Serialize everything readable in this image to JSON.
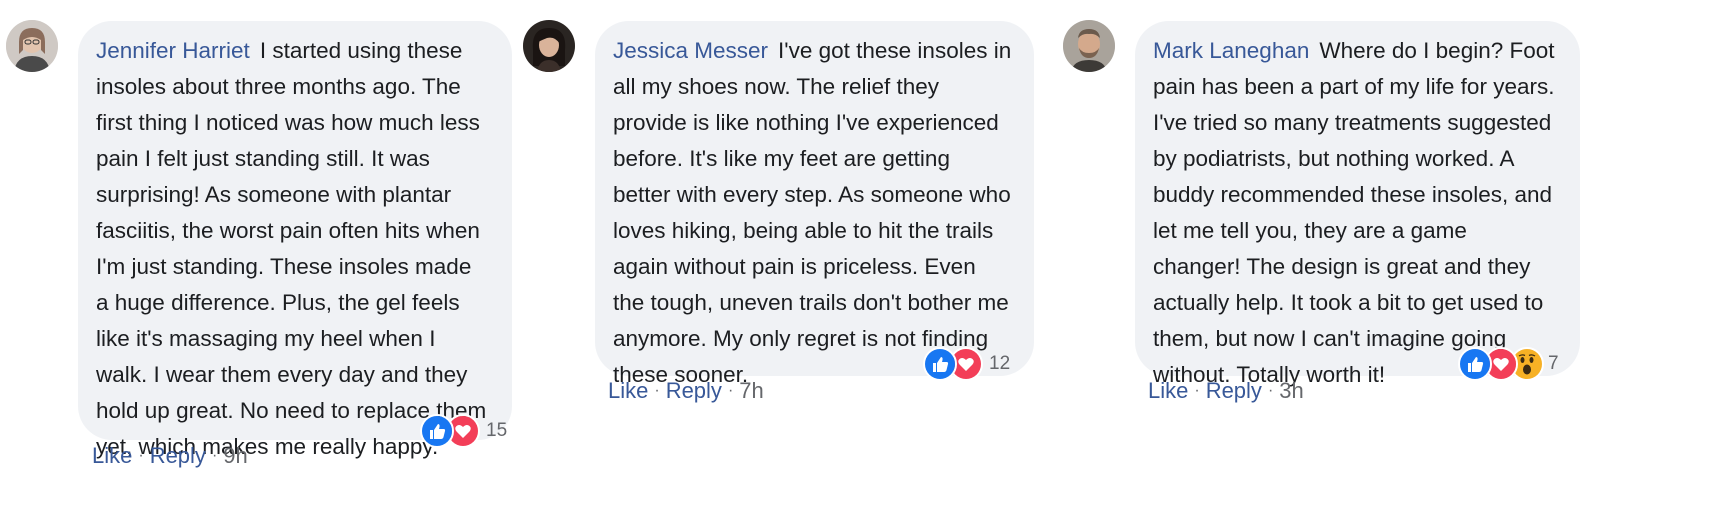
{
  "comments": [
    {
      "author": "Jennifer Harriet",
      "text": "I started using these insoles about three months ago. The first thing I noticed was how much less pain I felt just standing still. It was surprising! As someone with plantar fasciitis, the worst pain often hits when I'm just standing. These insoles made a huge difference. Plus, the gel feels like it's massaging my heel when I walk. I wear them every day and they hold up great. No need to replace them yet, which makes me really happy.",
      "reactions": [
        "like-icon",
        "love-icon"
      ],
      "reaction_count": "15",
      "like_label": "Like",
      "reply_label": "Reply",
      "separator": "·",
      "time": "9h"
    },
    {
      "author": "Jessica Messer",
      "text": "I've got these insoles in all my shoes now. The relief they provide is like nothing I've experienced before. It's like my feet are getting better with every step. As someone who loves hiking, being able to hit the trails again without pain is priceless. Even the tough, uneven trails don't bother me anymore. My only regret is not finding these sooner.",
      "reactions": [
        "like-icon",
        "love-icon"
      ],
      "reaction_count": "12",
      "like_label": "Like",
      "reply_label": "Reply",
      "separator": "·",
      "time": "7h"
    },
    {
      "author": "Mark Laneghan",
      "text": "Where do I begin? Foot pain has been a part of my life for years. I've tried so many treatments suggested by podiatrists, but nothing worked. A buddy recommended these insoles, and let me tell you, they are a game changer! The design is great and they actually help. It took a bit to get used to them, but now I can't imagine going without. Totally worth it!",
      "reactions": [
        "like-icon",
        "love-icon",
        "wow-icon"
      ],
      "reaction_count": "7",
      "like_label": "Like",
      "reply_label": "Reply",
      "separator": "·",
      "time": "3h"
    }
  ],
  "colors": {
    "bubble_bg": "#f0f2f5",
    "author": "#385898",
    "text": "#1c1e21",
    "meta": "#65676b",
    "like_blue": "#1877f2",
    "love_red": "#f33e58",
    "wow_yellow": "#f7b125"
  }
}
